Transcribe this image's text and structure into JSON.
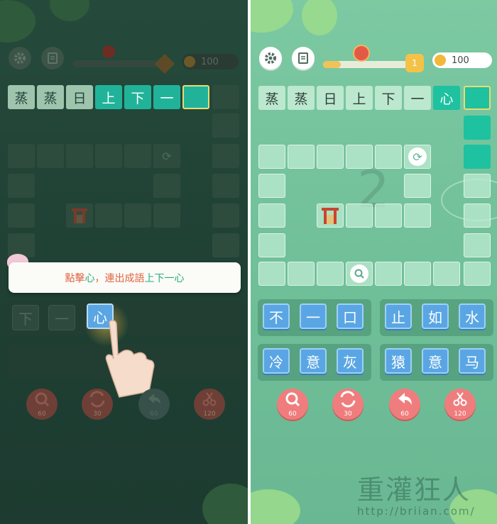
{
  "left": {
    "coins": "100",
    "top_row": [
      "蒸",
      "蒸",
      "日",
      "上",
      "下",
      "一",
      ""
    ],
    "tooltip": {
      "prefix": "點擊",
      "highlight": "心",
      "middle": "，連出成語",
      "idiom": "上下一心"
    },
    "keys": [
      "下",
      "一",
      "心"
    ],
    "tools": [
      {
        "icon": "magnifier-icon",
        "cost": "60"
      },
      {
        "icon": "shuffle-icon",
        "cost": "30"
      },
      {
        "icon": "undo-icon",
        "cost": "60"
      },
      {
        "icon": "scissors-icon",
        "cost": "120"
      }
    ]
  },
  "right": {
    "coins": "100",
    "level_badge": "1",
    "level_progress": 0.18,
    "top_row": [
      "蒸",
      "蒸",
      "日",
      "上",
      "下",
      "一",
      "心"
    ],
    "ghost_number": "2",
    "key_groups": [
      [
        "不",
        "一",
        "口"
      ],
      [
        "止",
        "如",
        "水"
      ],
      [
        "冷",
        "意",
        "灰"
      ],
      [
        "猿",
        "意",
        "马"
      ]
    ],
    "tools": [
      {
        "icon": "magnifier-icon",
        "cost": "60"
      },
      {
        "icon": "shuffle-icon",
        "cost": "30"
      },
      {
        "icon": "undo-icon",
        "cost": "60"
      },
      {
        "icon": "scissors-icon",
        "cost": "120"
      }
    ],
    "watermark": "重灌狂人",
    "watermark_url": "http://briian.com/"
  },
  "colors": {
    "teal": "#1ec1a0",
    "key_blue": "#5aa6e4",
    "tool_red": "#f07d7d",
    "tip_orange": "#e0653f",
    "tip_green": "#2bab7e"
  }
}
